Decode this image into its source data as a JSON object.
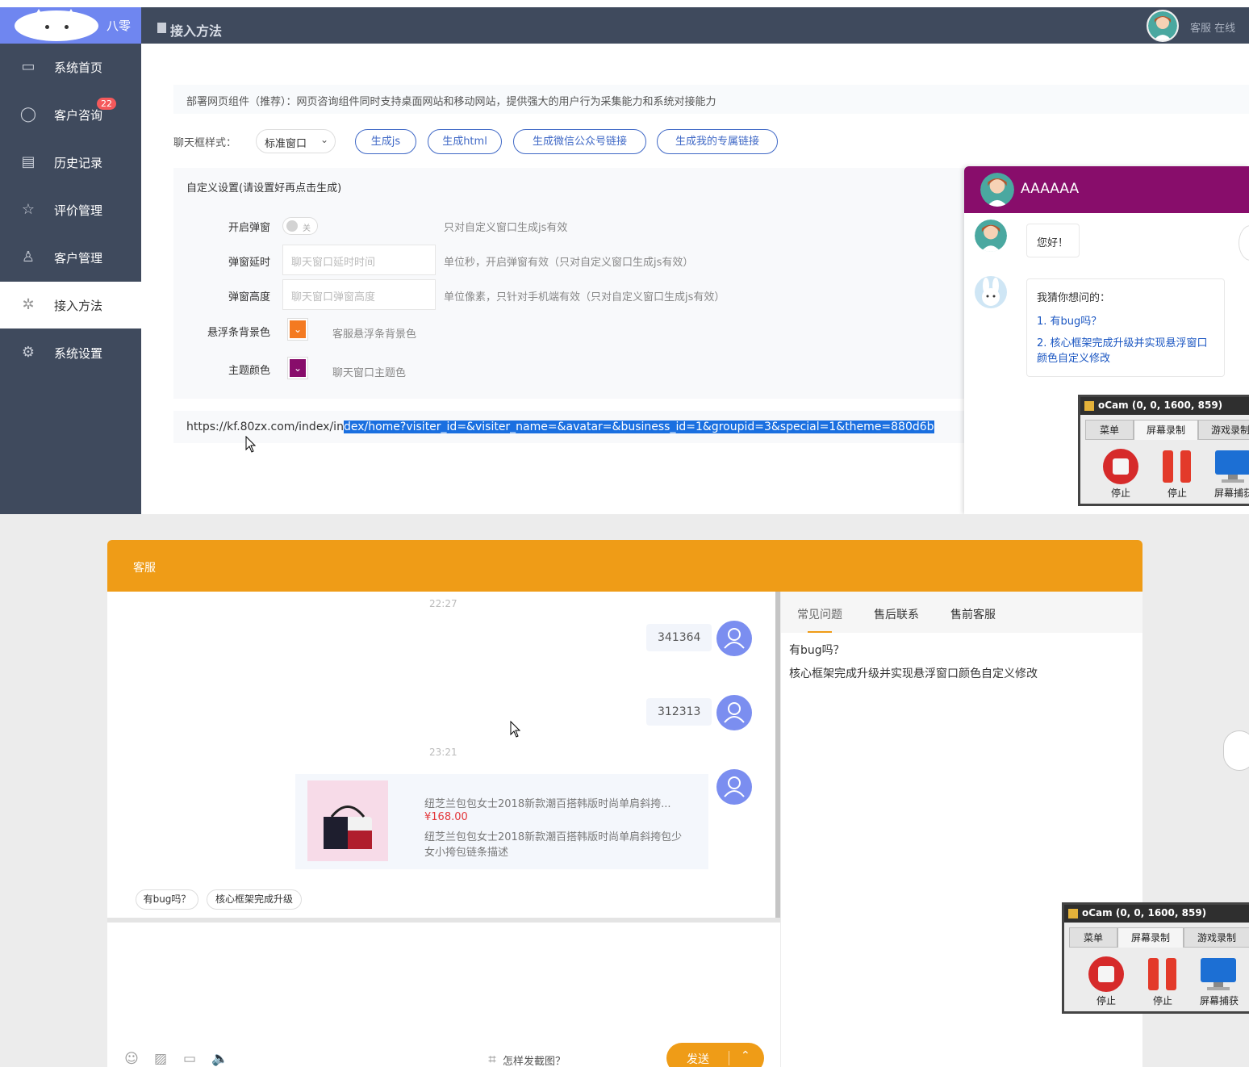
{
  "sidebar": {
    "brand": "八零",
    "items": [
      {
        "label": "系统首页",
        "icon": "window-icon"
      },
      {
        "label": "客户咨询",
        "icon": "chat-icon",
        "badge": "22"
      },
      {
        "label": "历史记录",
        "icon": "calendar-icon"
      },
      {
        "label": "评价管理",
        "icon": "star-icon"
      },
      {
        "label": "客户管理",
        "icon": "user-icon"
      },
      {
        "label": "接入方法",
        "icon": "link-icon",
        "active": true
      },
      {
        "label": "系统设置",
        "icon": "gear-icon"
      }
    ]
  },
  "header": {
    "title": "接入方法",
    "status": "客服 在线"
  },
  "content": {
    "tip": "部署网页组件（推荐）：网页咨询组件同时支持桌面网站和移动网站，提供强大的用户行为采集能力和系统对接能力",
    "style_label": "聊天框样式：",
    "style_value": "标准窗口",
    "buttons": [
      "生成js",
      "生成html",
      "生成微信公众号链接",
      "生成我的专属链接"
    ],
    "custom": {
      "title": "自定义设置(请设置好再点击生成)",
      "popup_label": "开启弹窗",
      "popup_toggle": "关",
      "popup_hint": "只对自定义窗口生成js有效",
      "delay_label": "弹窗延时",
      "delay_placeholder": "聊天窗口延时时间",
      "delay_hint": "单位秒，开启弹窗有效（只对自定义窗口生成js有效）",
      "height_label": "弹窗高度",
      "height_placeholder": "聊天窗口弹窗高度",
      "height_hint": "单位像素，只针对手机端有效（只对自定义窗口生成js有效）",
      "float_label": "悬浮条背景色",
      "float_hint": "客服悬浮条背景色",
      "float_color": "#f47a21",
      "theme_label": "主题颜色",
      "theme_hint": "聊天窗口主题色",
      "theme_color": "#880d6b"
    },
    "url_plain": "https://kf.80zx.com/index/in",
    "url_selected": "dex/home?visiter_id=&visiter_name=&avatar=&business_id=1&groupid=3&special=1&theme=880d6b"
  },
  "widget": {
    "title": "AAAAAA",
    "greeting": "您好！",
    "guess_title": "我猜你想问的：",
    "guess_items": [
      "1. 有bug吗？",
      "2. 核心框架完成升级并实现悬浮窗口颜色自定义修改"
    ],
    "theme_color": "#880d6b"
  },
  "ocam": {
    "title": "oCam (0, 0, 1600, 859)",
    "tabs": [
      "菜单",
      "屏幕录制",
      "游戏录制"
    ],
    "buttons": [
      "停止",
      "停止",
      "屏幕捕获"
    ]
  },
  "chat": {
    "header": "客服",
    "messages": [
      {
        "time": "22:27",
        "text": "341364"
      },
      {
        "text": "312313"
      },
      {
        "time": "23:21"
      }
    ],
    "product": {
      "title": "纽芝兰包包女士2018新款潮百搭韩版时尚单肩斜挎...",
      "price": "¥168.00",
      "desc": "纽芝兰包包女士2018新款潮百搭韩版时尚单肩斜挎包少女小挎包链条描述"
    },
    "quick_replies": [
      "有bug吗？",
      "核心框架完成升级"
    ],
    "screenshot_tip": "怎样发截图？",
    "send_label": "发送",
    "side_tabs": [
      "常见问题",
      "售后联系",
      "售前客服"
    ],
    "faq": [
      "有bug吗？",
      "核心框架完成升级并实现悬浮窗口颜色自定义修改"
    ],
    "accent": "#ef9c17"
  }
}
